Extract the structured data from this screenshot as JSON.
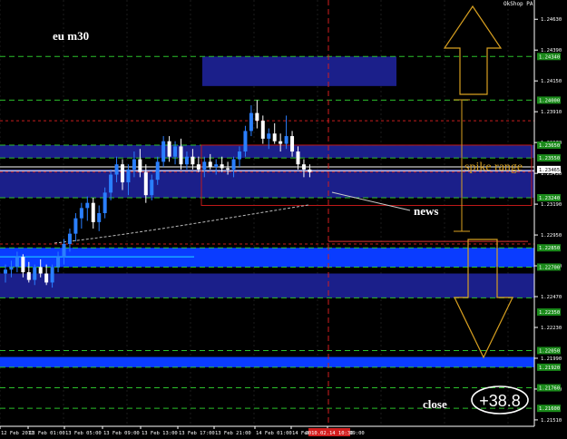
{
  "header": {
    "broker_label": "OkShop PA"
  },
  "annotations": {
    "symbol_label": "eu m30",
    "spike_range_label": "spike range",
    "news_label": "news",
    "close_label": "close",
    "close_value": "+38.8"
  },
  "price_scale": {
    "ticks": [
      "1.24630",
      "1.24390",
      "1.24150",
      "1.23910",
      "1.23670",
      "1.23430",
      "1.23190",
      "1.22950",
      "1.22710",
      "1.22470",
      "1.22230",
      "1.21990",
      "1.21750",
      "1.21510"
    ],
    "level_tags": [
      {
        "price": 1.2434,
        "text": "1.24340",
        "color": "#22aa22"
      },
      {
        "price": 1.24,
        "text": "1.24000",
        "color": "#22aa22"
      },
      {
        "price": 1.2365,
        "text": "1.23650",
        "color": "#22aa22"
      },
      {
        "price": 1.2355,
        "text": "1.23550",
        "color": "#22aa22"
      },
      {
        "price": 1.2346,
        "text": "1.23465",
        "color": "#ffffff"
      },
      {
        "price": 1.2324,
        "text": "1.23240",
        "color": "#22aa22"
      },
      {
        "price": 1.2285,
        "text": "1.22850",
        "color": "#22aa22"
      },
      {
        "price": 1.227,
        "text": "1.22700",
        "color": "#22aa22"
      },
      {
        "price": 1.2235,
        "text": "1.22350",
        "color": "#22aa22"
      },
      {
        "price": 1.2205,
        "text": "1.22050",
        "color": "#22aa22"
      },
      {
        "price": 1.2192,
        "text": "1.21920",
        "color": "#22aa22"
      },
      {
        "price": 1.2176,
        "text": "1.21760",
        "color": "#22aa22"
      },
      {
        "price": 1.216,
        "text": "1.21600",
        "color": "#22aa22"
      }
    ]
  },
  "time_scale": {
    "labels": [
      "12 Feb 2011",
      "13 Feb 01:00",
      "13 Feb 05:00",
      "13 Feb 09:00",
      "13 Feb 13:00",
      "13 Feb 17:00",
      "13 Feb 21:00",
      "14 Feb 01:00",
      "14 Feb 05:00",
      "14 Feb 09:00"
    ],
    "highlight_label": "2010.02.14 10:30"
  },
  "colors": {
    "background": "#000000",
    "bull_candle": "#2a7fff",
    "bear_candle": "#ffffff",
    "zone_fill": "#1b1f8a",
    "bright_zone": "#0a3cff",
    "green_level": "#2bbf2b",
    "red_dashed": "#c81e1e",
    "spike_box": "#c01818",
    "arrow": "#d8a020",
    "text": "#ffffff"
  },
  "chart_data": {
    "type": "candlestick",
    "symbol": "eu",
    "timeframe": "m30",
    "ylim": [
      1.2146,
      1.2478
    ],
    "candles": [
      [
        1.2265,
        1.2272,
        1.2258,
        1.2268
      ],
      [
        1.2268,
        1.2275,
        1.2262,
        1.227
      ],
      [
        1.227,
        1.2282,
        1.2266,
        1.2278
      ],
      [
        1.2278,
        1.228,
        1.2262,
        1.2266
      ],
      [
        1.2266,
        1.2274,
        1.2258,
        1.226
      ],
      [
        1.226,
        1.2272,
        1.2256,
        1.227
      ],
      [
        1.227,
        1.2276,
        1.2262,
        1.2265
      ],
      [
        1.2265,
        1.2272,
        1.2256,
        1.2258
      ],
      [
        1.2258,
        1.2272,
        1.2254,
        1.227
      ],
      [
        1.227,
        1.2282,
        1.2266,
        1.2278
      ],
      [
        1.2278,
        1.2292,
        1.2272,
        1.2288
      ],
      [
        1.2288,
        1.23,
        1.2282,
        1.2296
      ],
      [
        1.2296,
        1.2312,
        1.229,
        1.2308
      ],
      [
        1.2308,
        1.232,
        1.23,
        1.2316
      ],
      [
        1.2316,
        1.2325,
        1.2306,
        1.232
      ],
      [
        1.232,
        1.2324,
        1.23,
        1.2305
      ],
      [
        1.2305,
        1.2318,
        1.2298,
        1.2312
      ],
      [
        1.2312,
        1.2332,
        1.2308,
        1.2328
      ],
      [
        1.2328,
        1.2346,
        1.2322,
        1.2342
      ],
      [
        1.2342,
        1.2356,
        1.2336,
        1.235
      ],
      [
        1.235,
        1.2354,
        1.233,
        1.2336
      ],
      [
        1.2336,
        1.235,
        1.2326,
        1.2346
      ],
      [
        1.2346,
        1.236,
        1.234,
        1.2354
      ],
      [
        1.2354,
        1.2362,
        1.234,
        1.2344
      ],
      [
        1.2344,
        1.235,
        1.232,
        1.2326
      ],
      [
        1.2326,
        1.2342,
        1.2322,
        1.2338
      ],
      [
        1.2338,
        1.2356,
        1.2334,
        1.2352
      ],
      [
        1.2352,
        1.2372,
        1.2348,
        1.2368
      ],
      [
        1.2368,
        1.2372,
        1.2352,
        1.2356
      ],
      [
        1.2356,
        1.2368,
        1.235,
        1.2364
      ],
      [
        1.2364,
        1.237,
        1.2346,
        1.235
      ],
      [
        1.235,
        1.236,
        1.2346,
        1.2356
      ],
      [
        1.2356,
        1.2362,
        1.2346,
        1.235
      ],
      [
        1.235,
        1.2356,
        1.2344,
        1.2346
      ],
      [
        1.2346,
        1.2356,
        1.234,
        1.2352
      ],
      [
        1.2352,
        1.2358,
        1.2346,
        1.2348
      ],
      [
        1.2348,
        1.2354,
        1.2342,
        1.235
      ],
      [
        1.235,
        1.2356,
        1.2344,
        1.2347
      ],
      [
        1.2347,
        1.2352,
        1.2342,
        1.2346
      ],
      [
        1.2346,
        1.2356,
        1.234,
        1.2354
      ],
      [
        1.2354,
        1.2364,
        1.2348,
        1.236
      ],
      [
        1.236,
        1.238,
        1.2356,
        1.2376
      ],
      [
        1.2376,
        1.2396,
        1.2372,
        1.239
      ],
      [
        1.239,
        1.24,
        1.2378,
        1.2384
      ],
      [
        1.2384,
        1.2388,
        1.2366,
        1.237
      ],
      [
        1.237,
        1.2378,
        1.2362,
        1.2374
      ],
      [
        1.2374,
        1.2382,
        1.2366,
        1.2368
      ],
      [
        1.2368,
        1.2374,
        1.236,
        1.2366
      ],
      [
        1.2366,
        1.2388,
        1.2362,
        1.2372
      ],
      [
        1.2372,
        1.2376,
        1.2356,
        1.236
      ],
      [
        1.236,
        1.2364,
        1.2346,
        1.235
      ],
      [
        1.235,
        1.2354,
        1.234,
        1.2346
      ],
      [
        1.2346,
        1.235,
        1.234,
        1.2344
      ]
    ],
    "zones": [
      {
        "from": 1.2411,
        "to": 1.2434,
        "fill": "dark-blue"
      },
      {
        "from": 1.2355,
        "to": 1.2365,
        "fill": "dark-blue"
      },
      {
        "from": 1.2324,
        "to": 1.2346,
        "fill": "dark-blue"
      },
      {
        "from": 1.227,
        "to": 1.2285,
        "fill": "bright-blue"
      },
      {
        "from": 1.2246,
        "to": 1.2265,
        "fill": "dark-blue"
      },
      {
        "from": 1.2192,
        "to": 1.22,
        "fill": "bright-blue"
      }
    ],
    "green_dashed_levels": [
      1.2434,
      1.24,
      1.2365,
      1.2355,
      1.2324,
      1.2285,
      1.227,
      1.2246,
      1.2205,
      1.2192,
      1.2176,
      1.216
    ],
    "red_dashed_levels": [
      1.2384,
      1.2344,
      1.2288
    ],
    "solid_lines": [
      {
        "price": 1.2348,
        "color": "#ffffff"
      },
      {
        "price": 1.2345,
        "color": "#ffffff"
      },
      {
        "price": 1.2278,
        "color": "#22ddff"
      },
      {
        "price": 1.229,
        "color": "#dd3333"
      }
    ],
    "spike_box": {
      "top": 1.2365,
      "bottom": 1.2318
    },
    "news_time_label": "2010.02.14 10:30",
    "close_pips": 38.8
  }
}
